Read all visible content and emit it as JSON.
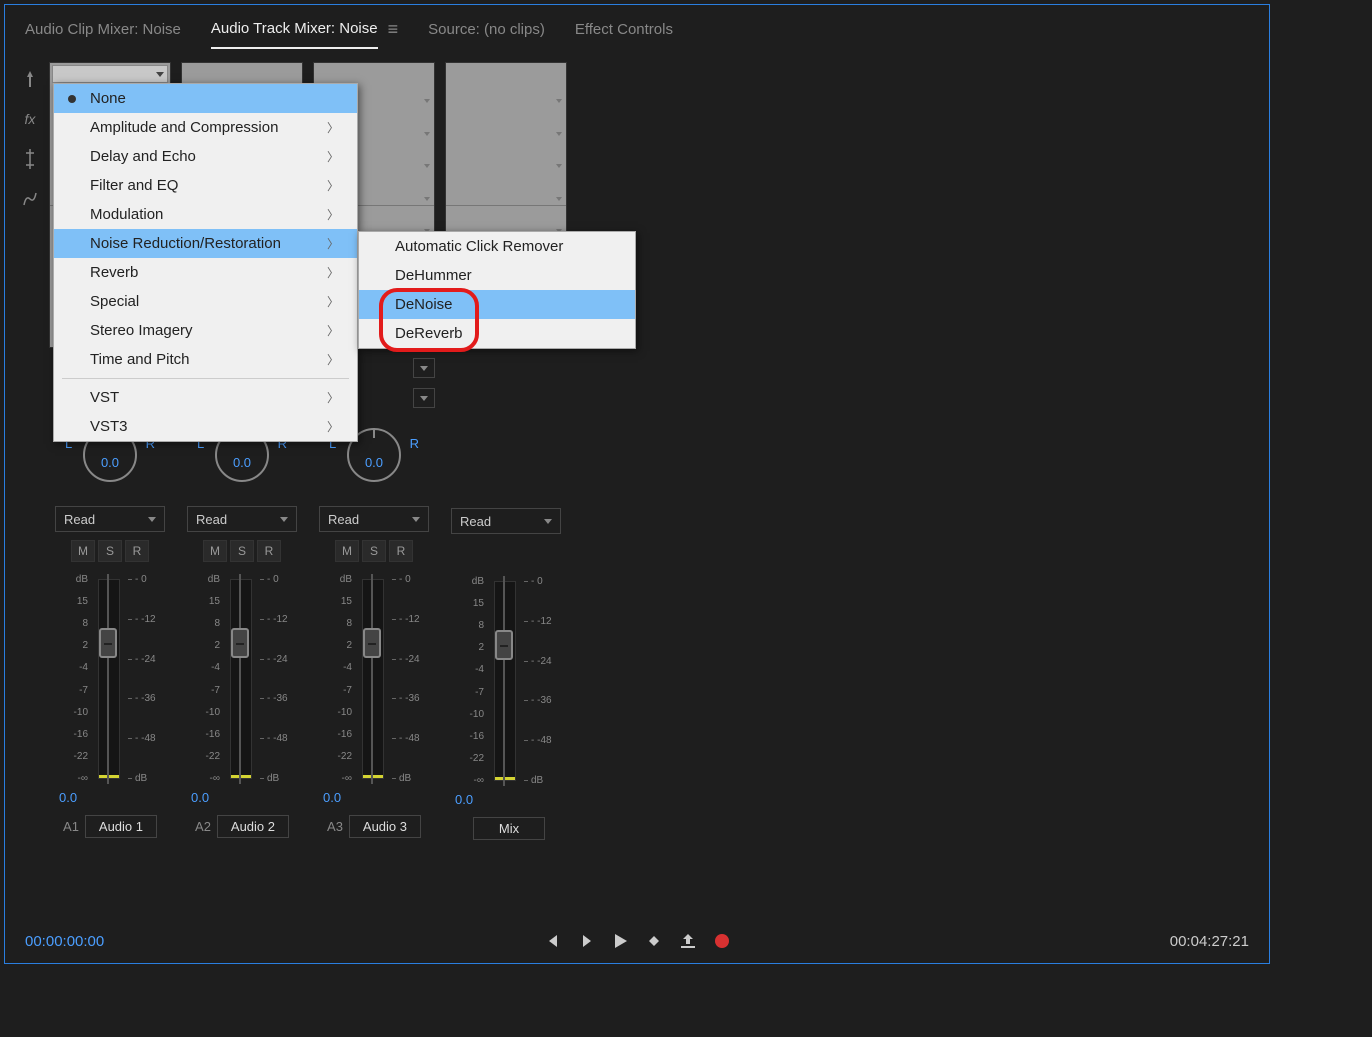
{
  "tabs": {
    "clip_mixer": "Audio Clip Mixer: Noise",
    "track_mixer": "Audio Track Mixer: Noise",
    "source": "Source: (no clips)",
    "effects": "Effect Controls"
  },
  "menu1": {
    "none": "None",
    "amp": "Amplitude and Compression",
    "delay": "Delay and Echo",
    "filter": "Filter and EQ",
    "mod": "Modulation",
    "noise": "Noise Reduction/Restoration",
    "reverb": "Reverb",
    "special": "Special",
    "stereo": "Stereo Imagery",
    "time": "Time and Pitch",
    "vst": "VST",
    "vst3": "VST3"
  },
  "menu2": {
    "click": "Automatic Click Remover",
    "dehum": "DeHummer",
    "denoise": "DeNoise",
    "dereverb": "DeReverb"
  },
  "pan": {
    "l": "L",
    "r": "R",
    "val": "0.0"
  },
  "automation": "Read",
  "msr": {
    "m": "M",
    "s": "S",
    "r": "R"
  },
  "fader_scale": [
    "dB",
    "15",
    "8",
    "2",
    "-4",
    "-7",
    "-10",
    "-16",
    "-22",
    "-∞"
  ],
  "meter_scale": [
    "- 0",
    "- -12",
    "- -24",
    "- -36",
    "- -48",
    "dB"
  ],
  "gain": "0.0",
  "tracks": [
    {
      "id": "A1",
      "name": "Audio 1"
    },
    {
      "id": "A2",
      "name": "Audio 2"
    },
    {
      "id": "A3",
      "name": "Audio 3"
    },
    {
      "id": "",
      "name": "Mix"
    }
  ],
  "timecode": "00:00:00:00",
  "duration": "00:04:27:21"
}
